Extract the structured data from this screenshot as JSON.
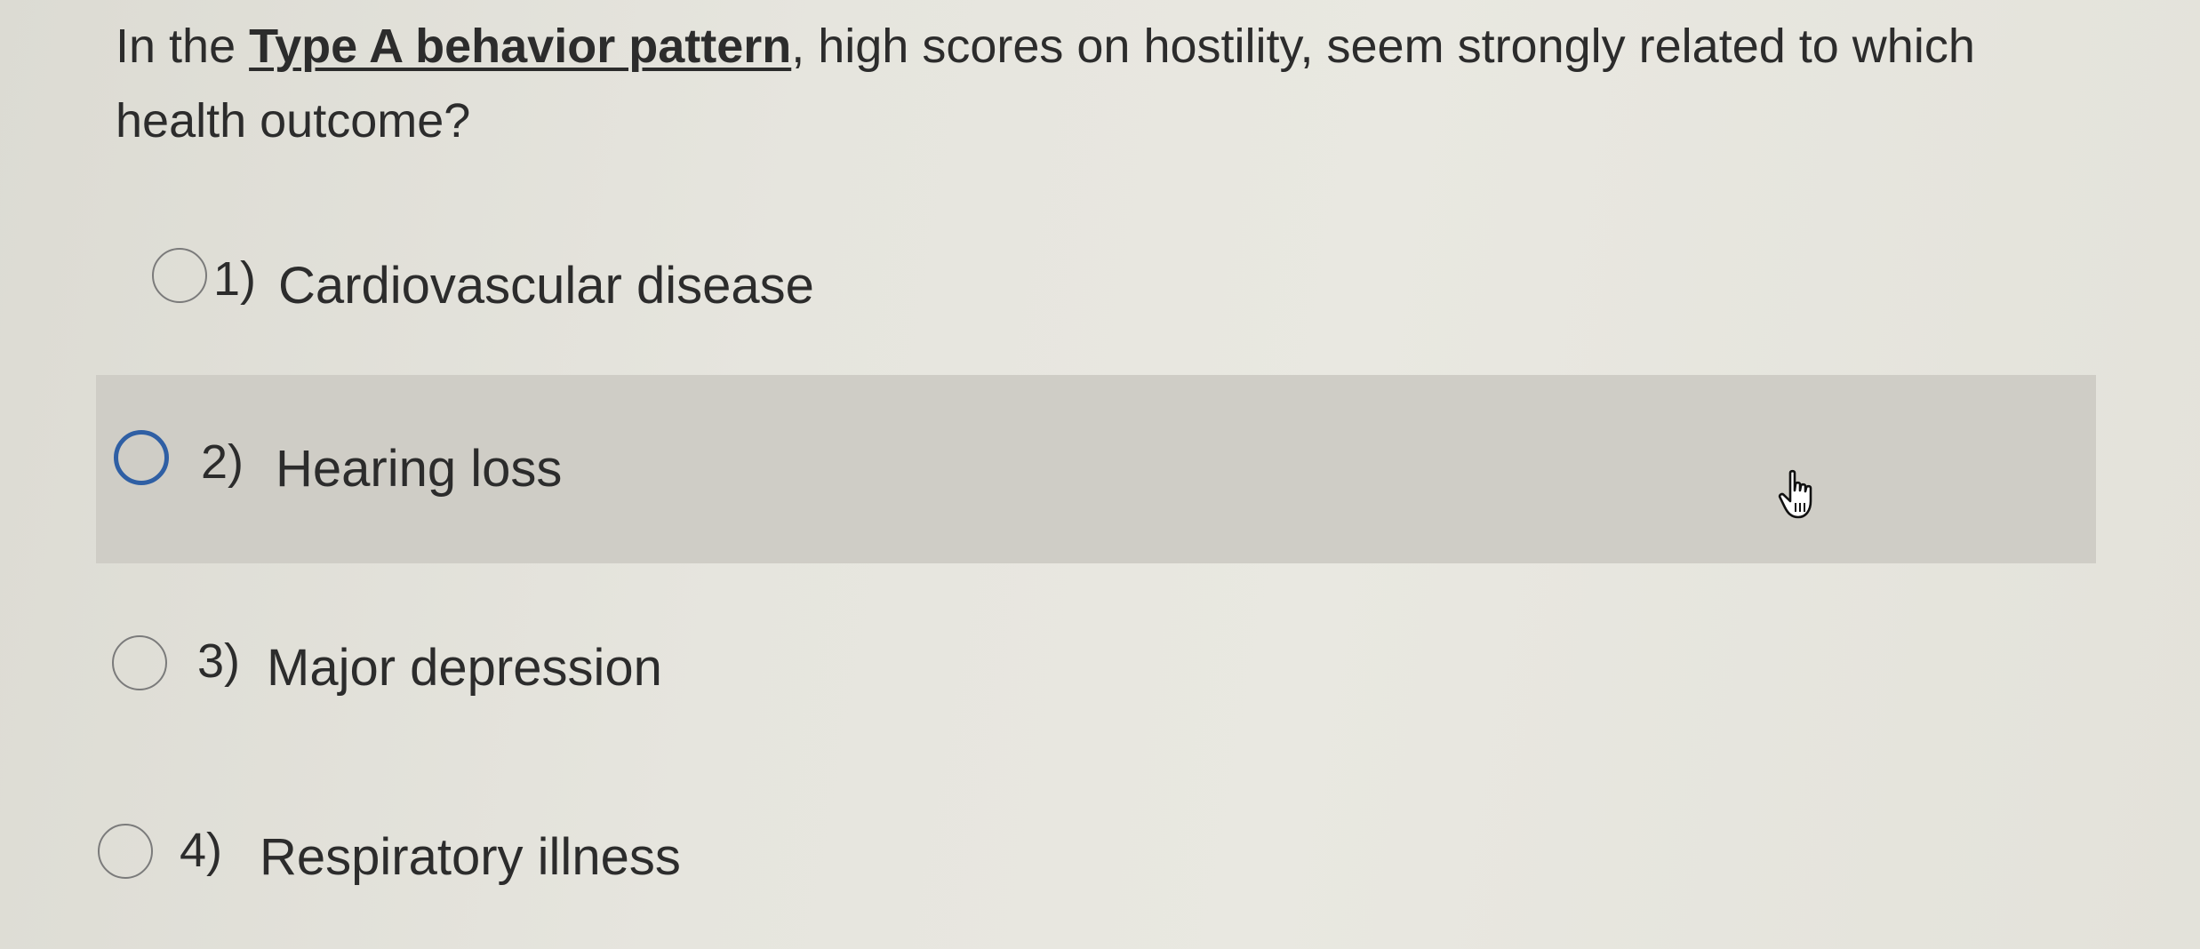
{
  "question": {
    "prefix": "In the ",
    "emphasis": "Type A behavior pattern",
    "suffix": ", high scores on hostility, seem strongly related to which health outcome?"
  },
  "options": [
    {
      "number": "1)",
      "label": "Cardiovascular disease",
      "selected": false
    },
    {
      "number": "2)",
      "label": "Hearing loss",
      "selected": false,
      "hovered": true
    },
    {
      "number": "3)",
      "label": "Major depression",
      "selected": false
    },
    {
      "number": "4)",
      "label": "Respiratory illness",
      "selected": false
    }
  ],
  "colors": {
    "background": "#e4e3dc",
    "hover_row": "#cfcdc6",
    "focus_ring": "#2f5fa4",
    "text": "#2c2c2c"
  },
  "cursor": {
    "icon": "hand-pointer-icon"
  }
}
